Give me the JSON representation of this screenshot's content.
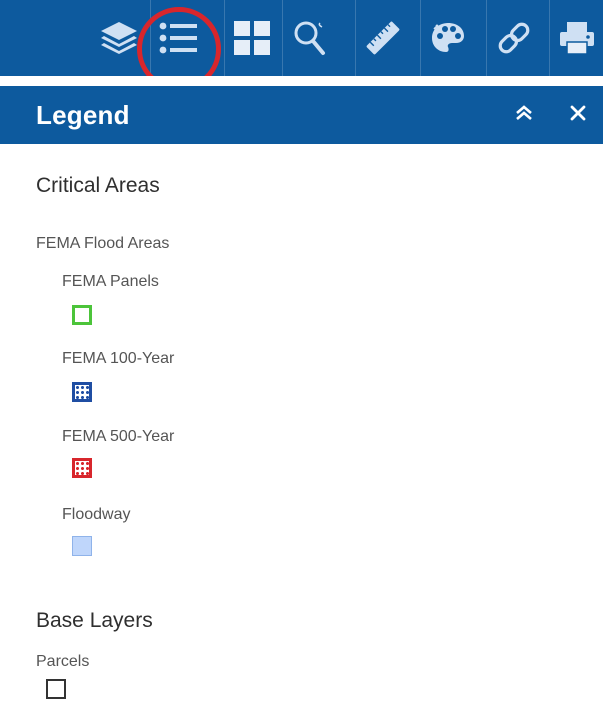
{
  "toolbar": {
    "tools": [
      {
        "name": "layers-icon",
        "label": ""
      },
      {
        "name": "legend-list-icon",
        "label": ""
      },
      {
        "name": "basemap-grid-icon",
        "label": ""
      },
      {
        "name": "search-icon",
        "label": ""
      },
      {
        "name": "measure-ruler-icon",
        "label": ""
      },
      {
        "name": "palette-icon",
        "label": ""
      },
      {
        "name": "link-icon",
        "label": ""
      },
      {
        "name": "print-icon",
        "label": ""
      }
    ],
    "background": "#0d5a9e",
    "highlight_color": "#d8262c"
  },
  "panel": {
    "title": "Legend",
    "collapse_glyph": "«",
    "close_glyph": "×"
  },
  "legend": {
    "groups": [
      {
        "title": "Critical Areas",
        "layers": [
          {
            "title": "FEMA Flood Areas",
            "items": [
              {
                "label": "FEMA Panels",
                "swatch": "outline",
                "color": "#4cc43a"
              },
              {
                "label": "FEMA 100-Year",
                "swatch": "dotted",
                "color": "#1f4ea3"
              },
              {
                "label": "FEMA 500-Year",
                "swatch": "dotted",
                "color": "#d8262c"
              },
              {
                "label": "Floodway",
                "swatch": "fill",
                "color": "#bfd6fb"
              }
            ]
          }
        ]
      },
      {
        "title": "Base Layers",
        "layers": [
          {
            "title": "Parcels",
            "items": [
              {
                "label": "",
                "swatch": "outline",
                "color": "#333333"
              }
            ]
          }
        ]
      }
    ]
  }
}
